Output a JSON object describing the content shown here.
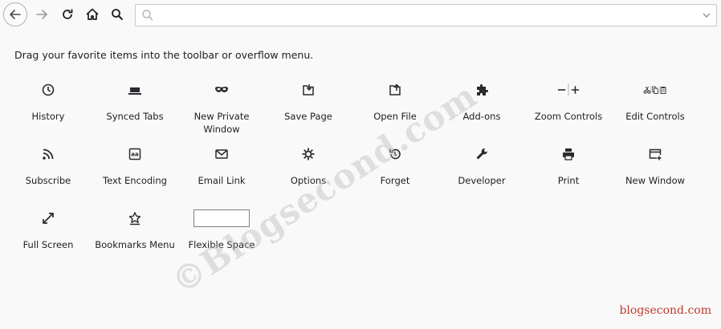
{
  "toolbar": {
    "url_placeholder": ""
  },
  "instructions": "Drag your favorite items into the toolbar or overflow menu.",
  "items": [
    {
      "label": "History",
      "icon": "history-icon"
    },
    {
      "label": "Synced Tabs",
      "icon": "synced-tabs-icon"
    },
    {
      "label": "New Private Window",
      "icon": "private-mask-icon"
    },
    {
      "label": "Save Page",
      "icon": "save-page-icon"
    },
    {
      "label": "Open File",
      "icon": "open-file-icon"
    },
    {
      "label": "Add-ons",
      "icon": "puzzle-icon"
    },
    {
      "label": "Zoom Controls",
      "icon": "zoom-icon"
    },
    {
      "label": "Edit Controls",
      "icon": "edit-controls-icon"
    },
    {
      "label": "Subscribe",
      "icon": "rss-icon"
    },
    {
      "label": "Text Encoding",
      "icon": "text-encoding-icon"
    },
    {
      "label": "Email Link",
      "icon": "envelope-icon"
    },
    {
      "label": "Options",
      "icon": "gear-icon"
    },
    {
      "label": "Forget",
      "icon": "forget-icon"
    },
    {
      "label": "Developer",
      "icon": "wrench-icon"
    },
    {
      "label": "Print",
      "icon": "printer-icon"
    },
    {
      "label": "New Window",
      "icon": "new-window-icon"
    },
    {
      "label": "Full Screen",
      "icon": "fullscreen-icon"
    },
    {
      "label": "Bookmarks Menu",
      "icon": "bookmarks-star-icon"
    },
    {
      "label": "Flexible Space",
      "icon": "flexible-space-box"
    }
  ],
  "watermark": "©Blogsecond.com",
  "brand": "blogsecond.com"
}
